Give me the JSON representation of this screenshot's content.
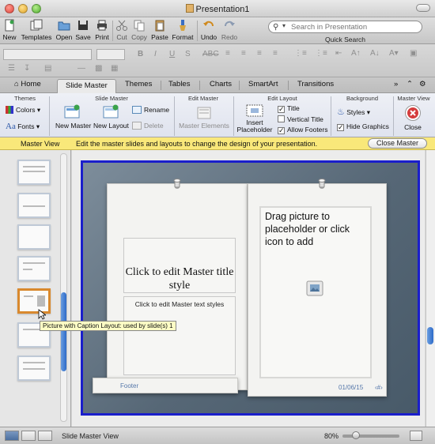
{
  "window": {
    "title": "Presentation1"
  },
  "toolbar": {
    "buttons": [
      {
        "label": "New",
        "icon": "new-document-icon"
      },
      {
        "label": "Templates",
        "icon": "templates-icon"
      },
      {
        "label": "Open",
        "icon": "open-folder-icon"
      },
      {
        "label": "Save",
        "icon": "save-icon"
      },
      {
        "label": "Print",
        "icon": "print-icon"
      },
      {
        "label": "Cut",
        "icon": "scissors-icon"
      },
      {
        "label": "Copy",
        "icon": "copy-icon"
      },
      {
        "label": "Paste",
        "icon": "paste-icon"
      },
      {
        "label": "Format",
        "icon": "format-brush-icon"
      },
      {
        "label": "Undo",
        "icon": "undo-icon"
      },
      {
        "label": "Redo",
        "icon": "redo-icon"
      }
    ],
    "search_placeholder": "Search in Presentation",
    "search_label": "Quick Search"
  },
  "ribbon_tabs": {
    "home": "Home",
    "slide_master": "Slide Master",
    "themes": "Themes",
    "tables": "Tables",
    "charts": "Charts",
    "smartart": "SmartArt",
    "transitions": "Transitions"
  },
  "ribbon": {
    "groups": {
      "themes": "Themes",
      "slide_master": "Slide Master",
      "edit_master": "Edit Master",
      "edit_layout": "Edit Layout",
      "background": "Background",
      "master_view": "Master View"
    },
    "colors": "Colors",
    "fonts": "Fonts",
    "fonts_icon_text": "Aa",
    "new_master": "New Master",
    "new_layout": "New Layout",
    "rename": "Rename",
    "delete": "Delete",
    "master_elements": "Master Elements",
    "insert_placeholder_1": "Insert",
    "insert_placeholder_2": "Placeholder",
    "title_chk": "Title",
    "vertical_title_chk": "Vertical Title",
    "allow_footers_chk": "Allow Footers",
    "styles": "Styles",
    "hide_graphics": "Hide Graphics",
    "close": "Close"
  },
  "message_bar": {
    "title": "Master View",
    "text": "Edit the master slides and layouts to change the design of your presentation.",
    "close_button": "Close Master"
  },
  "tooltip": "Picture with Caption Layout: used by slide(s) 1",
  "slide": {
    "title_placeholder": "Click to edit Master title style",
    "text_placeholder": "Click to edit Master text styles",
    "picture_placeholder": "Drag picture to placeholder or click icon to add",
    "footer": "Footer",
    "date": "01/06/15",
    "slide_number": "‹#›"
  },
  "statusbar": {
    "view_name": "Slide Master View",
    "zoom": "80%",
    "zoom_level": 0.23
  },
  "colors": {
    "selection_border": "#1a1ecb",
    "thumb_selected": "#d9892e",
    "message_bar": "#f9e87a",
    "close_red": "#d43c3c"
  }
}
